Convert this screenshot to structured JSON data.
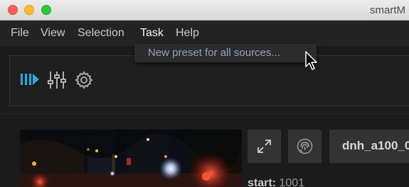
{
  "window": {
    "title": "smartM"
  },
  "menubar": {
    "items": [
      {
        "label": "File"
      },
      {
        "label": "View"
      },
      {
        "label": "Selection"
      },
      {
        "label": "Task"
      },
      {
        "label": "Help"
      }
    ],
    "active": "Task"
  },
  "task_menu": {
    "items": [
      {
        "label": "New preset for all sources..."
      }
    ]
  },
  "toolbar": {
    "icons": [
      "play-queue-icon",
      "sliders-icon",
      "gear-icon"
    ],
    "accent_color": "#2aa8e0"
  },
  "source": {
    "name": "dnh_a100_0",
    "start_label": "start:",
    "start_value": "1001"
  }
}
